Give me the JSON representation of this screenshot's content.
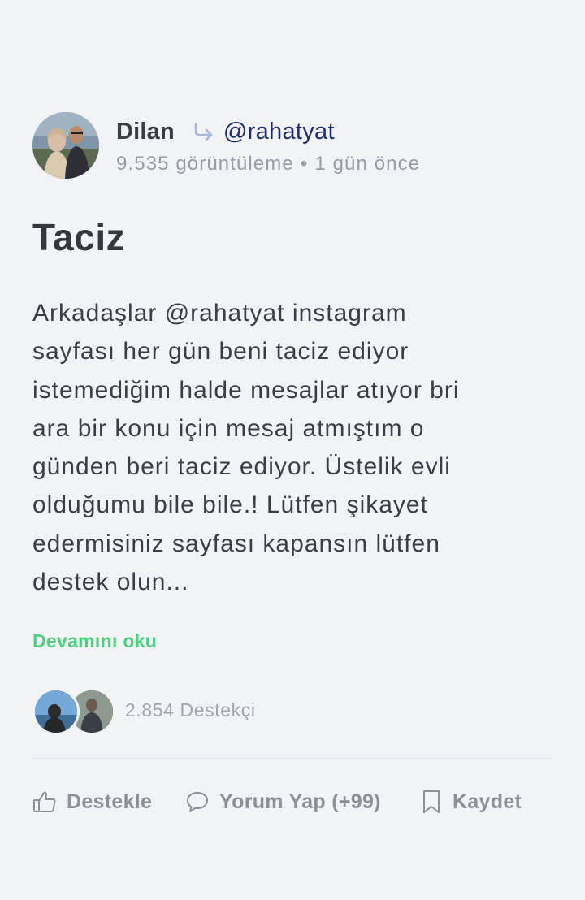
{
  "post": {
    "author": "Dilan",
    "target": "@rahatyat",
    "views": "9.535 görüntüleme",
    "separator": "•",
    "time": "1 gün önce",
    "title": "Taciz",
    "body": "Arkadaşlar @rahatyat instagram\nsayfası her gün beni taciz ediyor\nistemediğim halde mesajlar atıyor bri\nara bir konu için mesaj atmıştım o\ngünden beri taciz ediyor. Üstelik evli\nolduğumu bile bile.! Lütfen şikayet\nedermisiniz sayfası kapansın lütfen\ndestek olun...",
    "read_more": "Devamını oku"
  },
  "supporters": {
    "count_label": "2.854 Destekçi"
  },
  "actions": {
    "support_label": "Destekle",
    "comment_label": "Yorum Yap (+99)",
    "save_label": "Kaydet"
  },
  "icons": {
    "share": "share-arrow-icon",
    "support": "thumbs-up-icon",
    "comment": "speech-bubble-icon",
    "save": "bookmark-icon"
  },
  "colors": {
    "background": "#f2f3f7",
    "accent_green": "#4ed17f",
    "target_link": "#1f2d6d",
    "share_icon": "#a9b8da",
    "muted": "#9a9ca3"
  }
}
